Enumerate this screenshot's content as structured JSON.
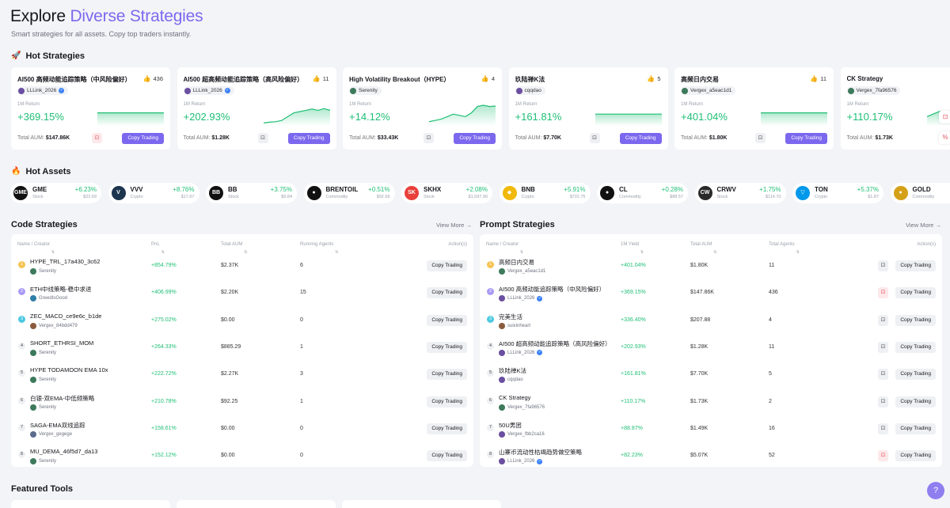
{
  "hero": {
    "title_main": "Explore ",
    "title_accent": "Diverse Strategies",
    "subtitle": "Smart strategies for all assets. Copy top traders instantly."
  },
  "sections": {
    "hot_strategies": "Hot Strategies",
    "hot_assets": "Hot Assets",
    "code_strategies": "Code Strategies",
    "prompt_strategies": "Prompt Strategies",
    "featured_tools": "Featured Tools",
    "view_more": "View More"
  },
  "colors": {
    "accent": "#7b68ee",
    "positive": "#1fbf75"
  },
  "hot_strategies": [
    {
      "name": "AI500 高频动能追踪策略（中风险偏好）",
      "count": "436",
      "creator": "LLLink_2026",
      "verified": true,
      "return_label": "1M Return",
      "return": "+369.15%",
      "aum_label": "Total AUM:",
      "aum": "$147.86K",
      "bookmark_red": true,
      "button": "Copy Trading",
      "spark": [
        0.45,
        0.45,
        0.45,
        0.45,
        0.45,
        0.45,
        0.45,
        0.45,
        0.45,
        0.45,
        0.45,
        0.45
      ]
    },
    {
      "name": "AI500 超高频动能追踪策略（高风险偏好）",
      "count": "11",
      "creator": "LLLink_2026",
      "verified": true,
      "return_label": "1M Return",
      "return": "+202.93%",
      "aum_label": "Total AUM:",
      "aum": "$1.28K",
      "bookmark_red": false,
      "button": "Copy Trading",
      "spark": [
        0.05,
        0.08,
        0.1,
        0.15,
        0.3,
        0.45,
        0.5,
        0.55,
        0.6,
        0.55,
        0.62,
        0.55
      ]
    },
    {
      "name": "High Volatility Breakout（HYPE）",
      "count": "4",
      "creator": "Serenity",
      "verified": false,
      "return_label": "1M Return",
      "return": "+14.12%",
      "aum_label": "Total AUM:",
      "aum": "$33.43K",
      "bookmark_red": false,
      "button": "Copy Trading",
      "spark": [
        0.1,
        0.15,
        0.2,
        0.3,
        0.4,
        0.35,
        0.3,
        0.45,
        0.7,
        0.75,
        0.7,
        0.72
      ]
    },
    {
      "name": "玖陆禅K法",
      "count": "5",
      "creator": "cqqdao",
      "verified": false,
      "return_label": "1M Return",
      "return": "+161.81%",
      "aum_label": "Total AUM:",
      "aum": "$7.70K",
      "bookmark_red": false,
      "button": "Copy Trading",
      "spark": [
        0.4,
        0.4,
        0.4,
        0.4,
        0.4,
        0.4,
        0.4,
        0.4,
        0.4,
        0.4,
        0.4,
        0.4
      ]
    },
    {
      "name": "高频日内交易",
      "count": "11",
      "creator": "Vergex_a5eac1d1",
      "verified": false,
      "return_label": "1M Return",
      "return": "+401.04%",
      "aum_label": "Total AUM:",
      "aum": "$1.80K",
      "bookmark_red": false,
      "button": "Copy Trading",
      "spark": [
        0.45,
        0.45,
        0.45,
        0.45,
        0.45,
        0.45,
        0.45,
        0.45,
        0.45,
        0.45,
        0.45,
        0.45
      ]
    },
    {
      "name": "CK Strategy",
      "count": "",
      "creator": "Vergex_7fa96576",
      "verified": false,
      "return_label": "1M Return",
      "return": "+110.17%",
      "aum_label": "Total AUM:",
      "aum": "$1.73K",
      "bookmark_red": false,
      "button": "",
      "spark": [
        0.3,
        0.4,
        0.5,
        0.5,
        0.5,
        0.5,
        0.5,
        0.5,
        0.5,
        0.5,
        0.5,
        0.5
      ]
    }
  ],
  "hot_assets": [
    {
      "symbol": "GME",
      "type": "Stock",
      "change": "+6.23%",
      "price": "$22.69",
      "logo": "GME",
      "logo_color": "#111111"
    },
    {
      "symbol": "VVV",
      "type": "Crypto",
      "change": "+8.76%",
      "price": "$17.67",
      "logo": "V",
      "logo_color": "#1e3550"
    },
    {
      "symbol": "BB",
      "type": "Stock",
      "change": "+3.75%",
      "price": "$9.84",
      "logo": "BB",
      "logo_color": "#111111"
    },
    {
      "symbol": "BRENTOIL",
      "type": "Commodity",
      "change": "+0.51%",
      "price": "$92.69",
      "logo": "●",
      "logo_color": "#111111"
    },
    {
      "symbol": "SKHX",
      "type": "Stock",
      "change": "+2.08%",
      "price": "$1,597.90",
      "logo": "SK",
      "logo_color": "#e8403a"
    },
    {
      "symbol": "BNB",
      "type": "Crypto",
      "change": "+5.91%",
      "price": "$722.75",
      "logo": "◆",
      "logo_color": "#f0b90b"
    },
    {
      "symbol": "CL",
      "type": "Commodity",
      "change": "+0.28%",
      "price": "$88.57",
      "logo": "●",
      "logo_color": "#111111"
    },
    {
      "symbol": "CRWV",
      "type": "Stock",
      "change": "+1.75%",
      "price": "$114.70",
      "logo": "CW",
      "logo_color": "#2a2a2a"
    },
    {
      "symbol": "TON",
      "type": "Crypto",
      "change": "+5.37%",
      "price": "$1.87",
      "logo": "▽",
      "logo_color": "#0098ea"
    },
    {
      "symbol": "GOLD",
      "type": "Commodity",
      "change": "",
      "price": "",
      "logo": "●",
      "logo_color": "#d4a017"
    }
  ],
  "code_table": {
    "headers": [
      "Name / Creator",
      "PnL",
      "Total AUM",
      "Running Agents",
      "Action(s)"
    ],
    "button": "Copy Trading",
    "rows": [
      {
        "rank": "1",
        "name": "HYPE_TRL_17a430_3c62",
        "creator": "Serenity",
        "pnl": "+854.79%",
        "aum": "$2.37K",
        "agents": "6"
      },
      {
        "rank": "2",
        "name": "ETH中线策略-稳中求进",
        "creator": "GreedIsGood",
        "pnl": "+406.99%",
        "aum": "$2.20K",
        "agents": "15"
      },
      {
        "rank": "3",
        "name": "ZEC_MACD_ce9e6c_b1de",
        "creator": "Vergex_84bdd479",
        "pnl": "+275.02%",
        "aum": "$0.00",
        "agents": "0"
      },
      {
        "rank": "4",
        "name": "SHORT_ETHRSI_MOM",
        "creator": "Serenity",
        "pnl": "+264.33%",
        "aum": "$885.29",
        "agents": "1"
      },
      {
        "rank": "5",
        "name": "HYPE TODAMOON EMA 10x",
        "creator": "Serenity",
        "pnl": "+222.72%",
        "aum": "$2.27K",
        "agents": "3"
      },
      {
        "rank": "6",
        "name": "白银-双EMA-中低频策略",
        "creator": "Serenity",
        "pnl": "+210.78%",
        "aum": "$92.25",
        "agents": "1"
      },
      {
        "rank": "7",
        "name": "SAGA-EMA双线追踪",
        "creator": "Vergex_gegege",
        "pnl": "+158.61%",
        "aum": "$0.00",
        "agents": "0"
      },
      {
        "rank": "8",
        "name": "MU_DEMA_46f5d7_da13",
        "creator": "Serenity",
        "pnl": "+152.12%",
        "aum": "$0.00",
        "agents": "0"
      }
    ]
  },
  "prompt_table": {
    "headers": [
      "Name / Creator",
      "1M Yield",
      "Total AUM",
      "Total Agents",
      "Action(s)"
    ],
    "button": "Copy Trading",
    "rows": [
      {
        "rank": "1",
        "name": "高频日内交易",
        "creator": "Vergex_a5eac1d1",
        "verified": false,
        "yield": "+401.04%",
        "aum": "$1.80K",
        "agents": "11",
        "bookmark_red": false
      },
      {
        "rank": "2",
        "name": "AI500 高频动能追踪策略（中风险偏好）",
        "creator": "LLLink_2026",
        "verified": true,
        "yield": "+369.15%",
        "aum": "$147.86K",
        "agents": "436",
        "bookmark_red": true
      },
      {
        "rank": "3",
        "name": "完美生活",
        "creator": "suixinheart",
        "verified": false,
        "yield": "+336.40%",
        "aum": "$207.88",
        "agents": "4",
        "bookmark_red": false
      },
      {
        "rank": "4",
        "name": "AI500 超高频动能追踪策略（高风险偏好）",
        "creator": "LLLink_2026",
        "verified": true,
        "yield": "+202.93%",
        "aum": "$1.28K",
        "agents": "11",
        "bookmark_red": false
      },
      {
        "rank": "5",
        "name": "玖陆禅K法",
        "creator": "cqqdao",
        "verified": false,
        "yield": "+161.81%",
        "aum": "$7.70K",
        "agents": "5",
        "bookmark_red": false
      },
      {
        "rank": "6",
        "name": "CK Strategy",
        "creator": "Vergex_7fa96576",
        "verified": false,
        "yield": "+110.17%",
        "aum": "$1.73K",
        "agents": "2",
        "bookmark_red": false
      },
      {
        "rank": "7",
        "name": "50U男团",
        "creator": "Vergex_fbb2ca16",
        "verified": false,
        "yield": "+88.87%",
        "aum": "$1.49K",
        "agents": "16",
        "bookmark_red": false
      },
      {
        "rank": "8",
        "name": "山寨币流动性枯竭趋势做空策略",
        "creator": "LLLink_2026",
        "verified": true,
        "yield": "+82.23%",
        "aum": "$5.07K",
        "agents": "52",
        "bookmark_red": true
      }
    ]
  }
}
